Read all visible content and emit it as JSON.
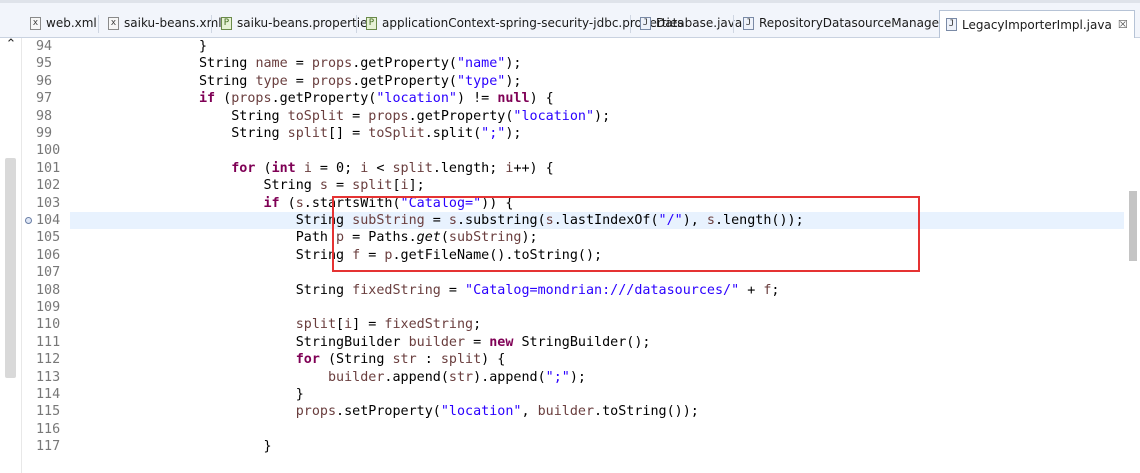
{
  "tabs": [
    {
      "label": "web.xml",
      "icon": "xml-file-icon"
    },
    {
      "label": "saiku-beans.xml",
      "icon": "xml-file-icon"
    },
    {
      "label": "saiku-beans.properties",
      "icon": "properties-file-icon"
    },
    {
      "label": "applicationContext-spring-security-jdbc.properties",
      "icon": "properties-file-icon"
    },
    {
      "label": "Database.java",
      "icon": "java-file-icon"
    },
    {
      "label": "RepositoryDatasourceManager.java",
      "icon": "java-file-icon"
    },
    {
      "label": "LegacyImporterImpl.java",
      "icon": "java-file-icon",
      "active": true,
      "close": "☒"
    }
  ],
  "editor": {
    "current_line": 104,
    "lines": [
      {
        "n": "94"
      },
      {
        "n": "95"
      },
      {
        "n": "96"
      },
      {
        "n": "97"
      },
      {
        "n": "98"
      },
      {
        "n": "99"
      },
      {
        "n": "100"
      },
      {
        "n": "101"
      },
      {
        "n": "102"
      },
      {
        "n": "103"
      },
      {
        "n": "104"
      },
      {
        "n": "105"
      },
      {
        "n": "106"
      },
      {
        "n": "107"
      },
      {
        "n": "108"
      },
      {
        "n": "109"
      },
      {
        "n": "110"
      },
      {
        "n": "111"
      },
      {
        "n": "112"
      },
      {
        "n": "113"
      },
      {
        "n": "114"
      },
      {
        "n": "115"
      },
      {
        "n": "116"
      },
      {
        "n": "117"
      }
    ],
    "code": [
      [
        [
          "p",
          "                }"
        ]
      ],
      [
        [
          "p",
          "                String "
        ],
        [
          "v",
          "name"
        ],
        [
          "p",
          " = "
        ],
        [
          "v",
          "props"
        ],
        [
          "p",
          ".getProperty("
        ],
        [
          "s",
          "\"name\""
        ],
        [
          "p",
          ");"
        ]
      ],
      [
        [
          "p",
          "                String "
        ],
        [
          "v",
          "type"
        ],
        [
          "p",
          " = "
        ],
        [
          "v",
          "props"
        ],
        [
          "p",
          ".getProperty("
        ],
        [
          "s",
          "\"type\""
        ],
        [
          "p",
          ");"
        ]
      ],
      [
        [
          "p",
          "                "
        ],
        [
          "k",
          "if"
        ],
        [
          "p",
          " ("
        ],
        [
          "v",
          "props"
        ],
        [
          "p",
          ".getProperty("
        ],
        [
          "s",
          "\"location\""
        ],
        [
          "p",
          ") != "
        ],
        [
          "k",
          "null"
        ],
        [
          "p",
          ") {"
        ]
      ],
      [
        [
          "p",
          "                    String "
        ],
        [
          "v",
          "toSplit"
        ],
        [
          "p",
          " = "
        ],
        [
          "v",
          "props"
        ],
        [
          "p",
          ".getProperty("
        ],
        [
          "s",
          "\"location\""
        ],
        [
          "p",
          ");"
        ]
      ],
      [
        [
          "p",
          "                    String "
        ],
        [
          "v",
          "split"
        ],
        [
          "p",
          "[] = "
        ],
        [
          "v",
          "toSplit"
        ],
        [
          "p",
          ".split("
        ],
        [
          "s",
          "\";\""
        ],
        [
          "p",
          ");"
        ]
      ],
      [],
      [
        [
          "p",
          "                    "
        ],
        [
          "k",
          "for"
        ],
        [
          "p",
          " ("
        ],
        [
          "k",
          "int"
        ],
        [
          "p",
          " "
        ],
        [
          "v",
          "i"
        ],
        [
          "p",
          " = 0; "
        ],
        [
          "v",
          "i"
        ],
        [
          "p",
          " < "
        ],
        [
          "v",
          "split"
        ],
        [
          "p",
          ".length; "
        ],
        [
          "v",
          "i"
        ],
        [
          "p",
          "++) {"
        ]
      ],
      [
        [
          "p",
          "                        String "
        ],
        [
          "v",
          "s"
        ],
        [
          "p",
          " = "
        ],
        [
          "v",
          "split"
        ],
        [
          "p",
          "["
        ],
        [
          "v",
          "i"
        ],
        [
          "p",
          "];"
        ]
      ],
      [
        [
          "p",
          "                        "
        ],
        [
          "k",
          "if"
        ],
        [
          "p",
          " ("
        ],
        [
          "v",
          "s"
        ],
        [
          "p",
          ".startsWith("
        ],
        [
          "s",
          "\"Catalog=\""
        ],
        [
          "p",
          ")) {"
        ]
      ],
      [
        [
          "p",
          "                            String "
        ],
        [
          "v",
          "subString"
        ],
        [
          "p",
          " = "
        ],
        [
          "v",
          "s"
        ],
        [
          "p",
          ".substring("
        ],
        [
          "v",
          "s"
        ],
        [
          "p",
          ".lastIndexOf("
        ],
        [
          "s",
          "\"/\""
        ],
        [
          "p",
          "), "
        ],
        [
          "v",
          "s"
        ],
        [
          "p",
          ".length());"
        ]
      ],
      [
        [
          "p",
          "                            Path "
        ],
        [
          "v",
          "p"
        ],
        [
          "p",
          " = Paths."
        ],
        [
          "i",
          "get"
        ],
        [
          "p",
          "("
        ],
        [
          "v",
          "subString"
        ],
        [
          "p",
          ");"
        ]
      ],
      [
        [
          "p",
          "                            String "
        ],
        [
          "v",
          "f"
        ],
        [
          "p",
          " = "
        ],
        [
          "v",
          "p"
        ],
        [
          "p",
          ".getFileName().toString();"
        ]
      ],
      [],
      [
        [
          "p",
          "                            String "
        ],
        [
          "v",
          "fixedString"
        ],
        [
          "p",
          " = "
        ],
        [
          "s",
          "\"Catalog=mondrian:///datasources/\""
        ],
        [
          "p",
          " + "
        ],
        [
          "v",
          "f"
        ],
        [
          "p",
          ";"
        ]
      ],
      [],
      [
        [
          "p",
          "                            "
        ],
        [
          "v",
          "split"
        ],
        [
          "p",
          "["
        ],
        [
          "v",
          "i"
        ],
        [
          "p",
          "] = "
        ],
        [
          "v",
          "fixedString"
        ],
        [
          "p",
          ";"
        ]
      ],
      [
        [
          "p",
          "                            StringBuilder "
        ],
        [
          "v",
          "builder"
        ],
        [
          "p",
          " = "
        ],
        [
          "k",
          "new"
        ],
        [
          "p",
          " StringBuilder();"
        ]
      ],
      [
        [
          "p",
          "                            "
        ],
        [
          "k",
          "for"
        ],
        [
          "p",
          " (String "
        ],
        [
          "v",
          "str"
        ],
        [
          "p",
          " : "
        ],
        [
          "v",
          "split"
        ],
        [
          "p",
          ") {"
        ]
      ],
      [
        [
          "p",
          "                                "
        ],
        [
          "v",
          "builder"
        ],
        [
          "p",
          ".append("
        ],
        [
          "v",
          "str"
        ],
        [
          "p",
          ").append("
        ],
        [
          "s",
          "\";\""
        ],
        [
          "p",
          ");"
        ]
      ],
      [
        [
          "p",
          "                            }"
        ]
      ],
      [
        [
          "p",
          "                            "
        ],
        [
          "v",
          "props"
        ],
        [
          "p",
          ".setProperty("
        ],
        [
          "s",
          "\"location\""
        ],
        [
          "p",
          ", "
        ],
        [
          "v",
          "builder"
        ],
        [
          "p",
          ".toString());"
        ]
      ],
      [],
      [
        [
          "p",
          "                        }"
        ]
      ]
    ]
  },
  "annotation": {
    "color": "#e53333"
  },
  "icons": {
    "chevron": "chevron-up-icon"
  }
}
